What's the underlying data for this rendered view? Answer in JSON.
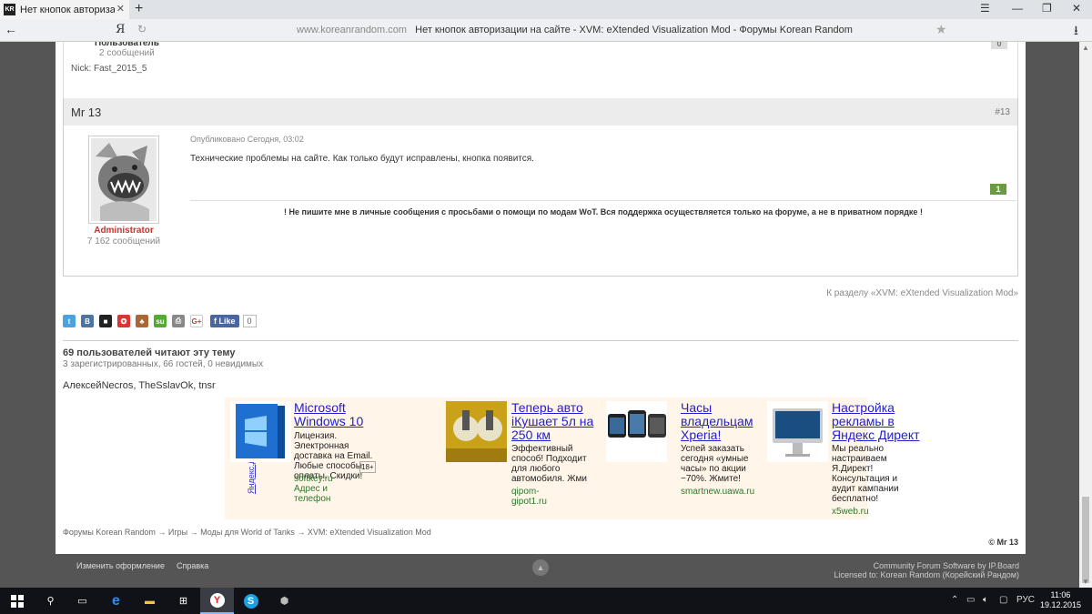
{
  "browser": {
    "tab_title": "Нет кнопок авторизаци",
    "url_host": "www.koreanrandom.com",
    "page_title": "Нет кнопок авторизации на сайте - XVM: eXtended Visualization Mod - Форумы Korean Random",
    "yandex": "Я"
  },
  "prev_post": {
    "role": "Пользователь",
    "count": "2 сообщений",
    "nick": "Nick: Fast_2015_5",
    "rep": "0"
  },
  "post": {
    "author": "Mr 13",
    "number": "#13",
    "date": "Опубликовано Сегодня, 03:02",
    "text": "Технические проблемы на сайте. Как только будут исправлены, кнопка появится.",
    "role": "Administrator",
    "count": "7 162 сообщений",
    "rep": "1",
    "signature": "! Не пишите мне в личные сообщения с просьбами о помощи по модам WoT. Вся поддержка осуществляется только на форуме, а не в приватном порядке !"
  },
  "back_link": "К разделу «XVM: eXtended Visualization Mod»",
  "social": {
    "like": "Like",
    "like_count": "0"
  },
  "viewers": {
    "title": "69 пользователей читают эту тему",
    "counts": "3 зарегистрированных, 66 гостей, 0 невидимых",
    "users": "АлексейNecros, TheSslavOk, tnsr"
  },
  "ads": {
    "label": "Яндекс.Директ",
    "items": [
      {
        "title": "Microsoft Windows 10",
        "text": "Лицензия. Электронная доставка на Email. Любые способы оплаты. Скидки!",
        "age": "18+",
        "url": "softkey.ru",
        "extra": "Адрес и телефон"
      },
      {
        "title": "Теперь авто iКушает 5л на 250 км",
        "text": "Эффективный способ! Подходит для любого автомобиля. Жми",
        "url": "qipom-gipot1.ru"
      },
      {
        "title": "Часы владельцам Xperia!",
        "text": "Успей заказать сегодня «умные часы» по акции −70%. Жмите!",
        "url": "smartnew.uawa.ru"
      },
      {
        "title": "Настройка рекламы в Яндекс Директ",
        "text": "Мы реально настраиваем Я.Директ! Консультация и аудит кампании бесплатно!",
        "url": "x5web.ru"
      }
    ]
  },
  "breadcrumbs": [
    "Форумы Korean Random",
    "Игры",
    "Моды для World of Tanks",
    "XVM: eXtended Visualization Mod"
  ],
  "breadcrumb_sep": "→",
  "copyright": "© Mr 13",
  "footer": {
    "theme": "Изменить оформление",
    "help": "Справка",
    "software": "Community Forum Software by IP.Board",
    "license": "Licensed to: Korean Random (Корейский Рандом)"
  },
  "taskbar": {
    "lang": "РУС",
    "time": "11:06",
    "date": "19.12.2015"
  }
}
